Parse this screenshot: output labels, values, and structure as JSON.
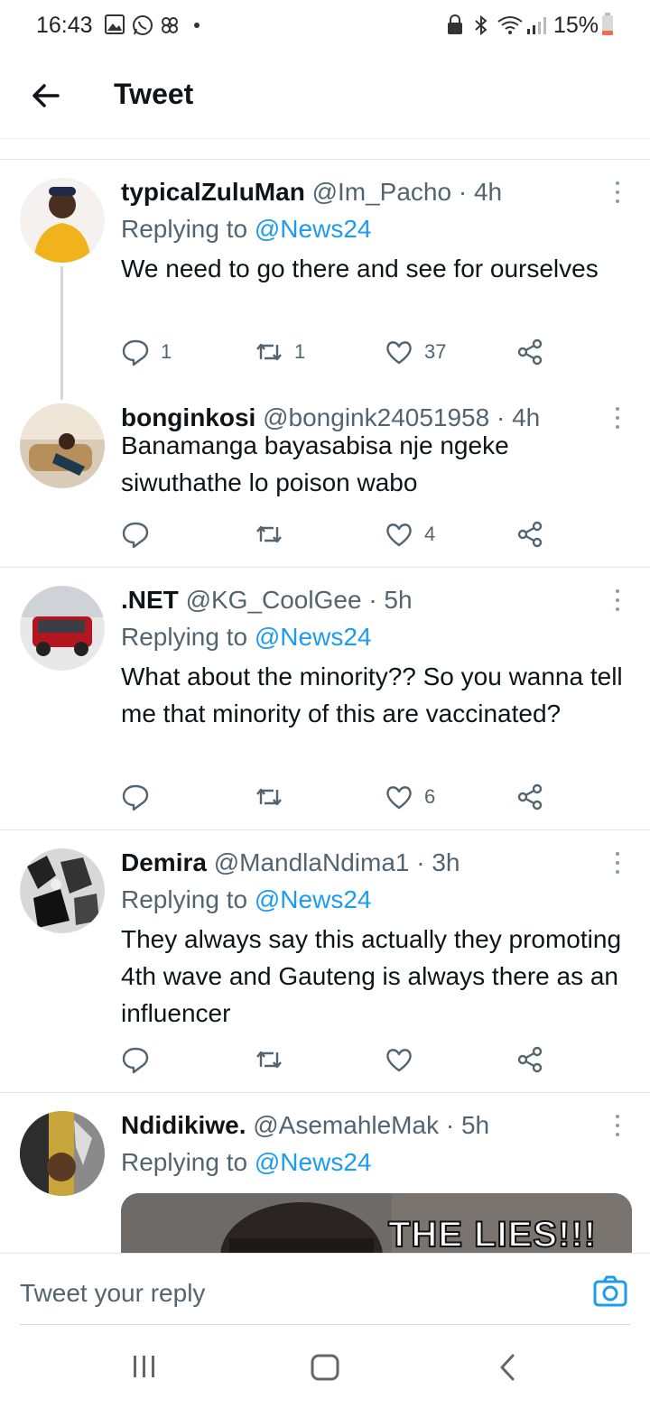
{
  "status_bar": {
    "time": "16:43",
    "battery": "15%",
    "icons": [
      "gallery-icon",
      "whatsapp-icon",
      "pinwheel-icon",
      "dot-icon",
      "lock-icon",
      "bluetooth-icon",
      "wifi-icon",
      "signal-icon",
      "battery-icon"
    ]
  },
  "header": {
    "title": "Tweet",
    "back_icon": "arrow-left-icon"
  },
  "tweets": [
    {
      "name": "typicalZuluMan",
      "handle": "@Im_Pacho",
      "time": "· 4h",
      "replying_prefix": "Replying to",
      "replying_to": "@News24",
      "text": "We need to go there and see for ourselves",
      "replies": "1",
      "retweets": "1",
      "likes": "37"
    },
    {
      "name": "bonginkosi",
      "handle": "@bongink24051958",
      "time": "· 4h",
      "text": "Banamanga bayasabisa nje ngeke siwuthathe lo poison wabo",
      "replies": "",
      "retweets": "",
      "likes": "4"
    },
    {
      "name": ".NET",
      "handle": "@KG_CoolGee",
      "time": "· 5h",
      "replying_prefix": "Replying to",
      "replying_to": "@News24",
      "text": "What about the minority?? So you wanna tell me that minority of this are vaccinated?",
      "replies": "",
      "retweets": "",
      "likes": "6"
    },
    {
      "name": "Demira",
      "handle": "@MandlaNdima1",
      "time": "· 3h",
      "replying_prefix": "Replying to",
      "replying_to": "@News24",
      "text": "They always say this actually they promoting 4th wave and Gauteng is always there as an influencer",
      "replies": "",
      "retweets": "",
      "likes": ""
    },
    {
      "name": "Ndidikiwe.",
      "handle": "@AsemahleMak",
      "time": "· 5h",
      "replying_prefix": "Replying to",
      "replying_to": "@News24",
      "media_caption": "THE LIES!!!"
    }
  ],
  "reply_bar": {
    "placeholder": "Tweet your reply",
    "camera_icon": "camera-icon"
  },
  "nav_bar": {
    "icons": [
      "recent-apps-icon",
      "home-icon",
      "back-icon"
    ]
  },
  "colors": {
    "accent": "#1d9bf0",
    "text": "#0f1419",
    "muted": "#536471",
    "divider": "#e1e6ea"
  }
}
